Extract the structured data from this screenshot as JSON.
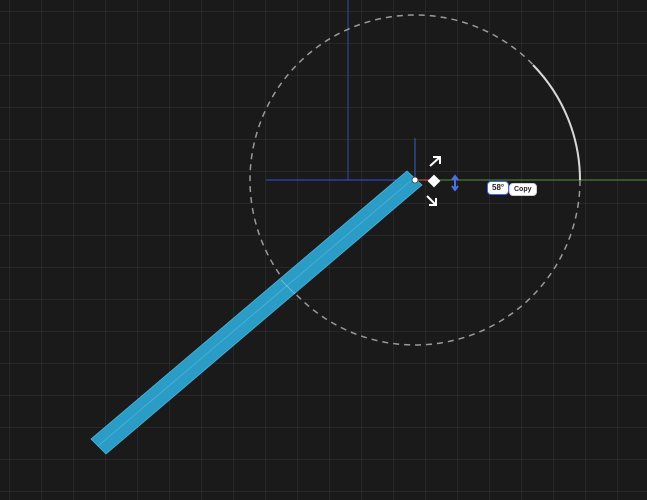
{
  "transform_gizmo": {
    "angle_label": "58°",
    "copy_label": "Copy"
  },
  "colors": {
    "background": "#1a1a1a",
    "beam_fill": "#2a9cc6",
    "x_axis": "#3b4fe0",
    "y_axis_dark": "#3b5fc0",
    "green_axis": "#5a8f3c",
    "rotation_ring": "#bdbdbd",
    "handle": "#ffffff",
    "badge_border": "#3a6fe0"
  },
  "icons": {
    "scale_up": "arrow-up-right-icon",
    "scale_down": "arrow-down-right-icon",
    "move_vertical": "arrow-up-down-icon",
    "center": "diamond-icon"
  }
}
